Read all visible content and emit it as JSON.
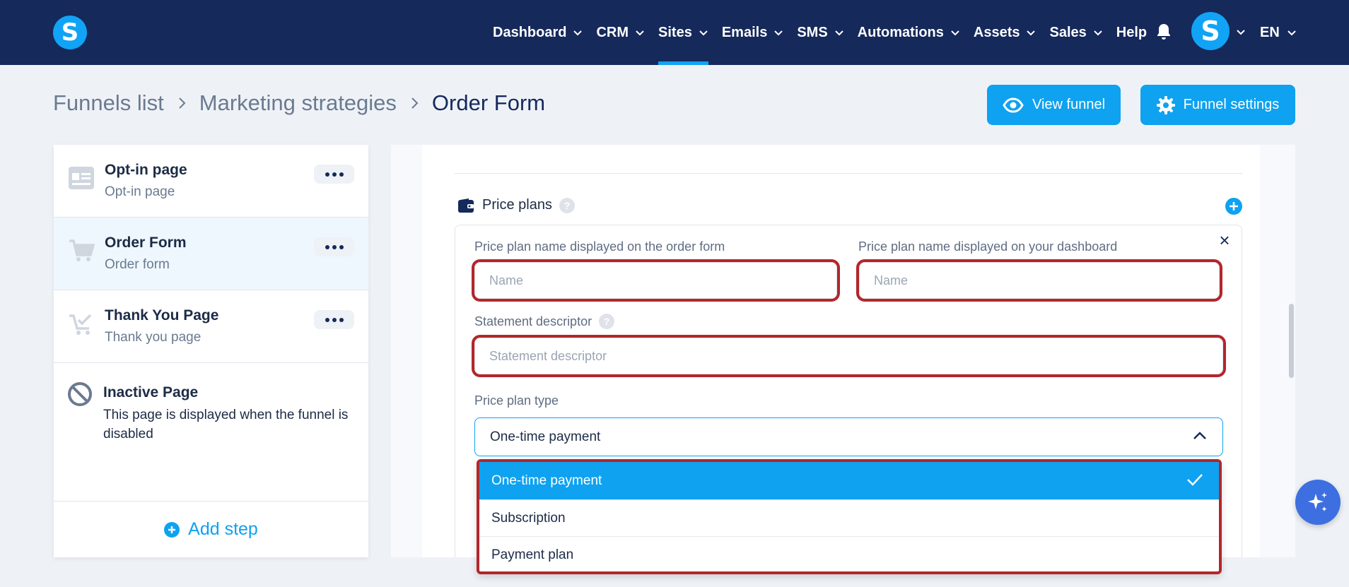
{
  "nav": {
    "items": [
      {
        "label": "Dashboard",
        "has_menu": true,
        "active": false
      },
      {
        "label": "CRM",
        "has_menu": true,
        "active": false
      },
      {
        "label": "Sites",
        "has_menu": true,
        "active": true
      },
      {
        "label": "Emails",
        "has_menu": true,
        "active": false
      },
      {
        "label": "SMS",
        "has_menu": true,
        "active": false
      },
      {
        "label": "Automations",
        "has_menu": true,
        "active": false
      },
      {
        "label": "Assets",
        "has_menu": true,
        "active": false
      },
      {
        "label": "Sales",
        "has_menu": true,
        "active": false
      },
      {
        "label": "Help",
        "has_menu": false,
        "active": false
      }
    ],
    "logo_letter": "S",
    "avatar_letter": "S",
    "language": "EN"
  },
  "breadcrumb": {
    "items": [
      "Funnels list",
      "Marketing strategies"
    ],
    "current": "Order Form"
  },
  "actions": {
    "view_funnel": "View funnel",
    "funnel_settings": "Funnel settings"
  },
  "steps": [
    {
      "title": "Opt-in page",
      "subtitle": "Opt-in page",
      "active": false,
      "icon": "page-layout-icon"
    },
    {
      "title": "Order Form",
      "subtitle": "Order form",
      "active": true,
      "icon": "cart-icon"
    },
    {
      "title": "Thank You Page",
      "subtitle": "Thank you page",
      "active": false,
      "icon": "cart-check-icon"
    }
  ],
  "inactive_page": {
    "title": "Inactive Page",
    "description": "This page is displayed when the funnel is disabled"
  },
  "add_step": "Add step",
  "price_plans": {
    "section_label": "Price plans",
    "fields": {
      "order_form_name_label": "Price plan name displayed on the order form",
      "order_form_name_placeholder": "Name",
      "dashboard_name_label": "Price plan name displayed on your dashboard",
      "dashboard_name_placeholder": "Name",
      "statement_label": "Statement descriptor",
      "statement_placeholder": "Statement descriptor",
      "type_label": "Price plan type",
      "type_value": "One-time payment"
    },
    "type_options": [
      {
        "label": "One-time payment",
        "selected": true
      },
      {
        "label": "Subscription",
        "selected": false
      },
      {
        "label": "Payment plan",
        "selected": false
      }
    ]
  },
  "colors": {
    "nav_bg": "#15295b",
    "accent": "#0ea2f0",
    "highlight_outline": "#b3262a"
  }
}
